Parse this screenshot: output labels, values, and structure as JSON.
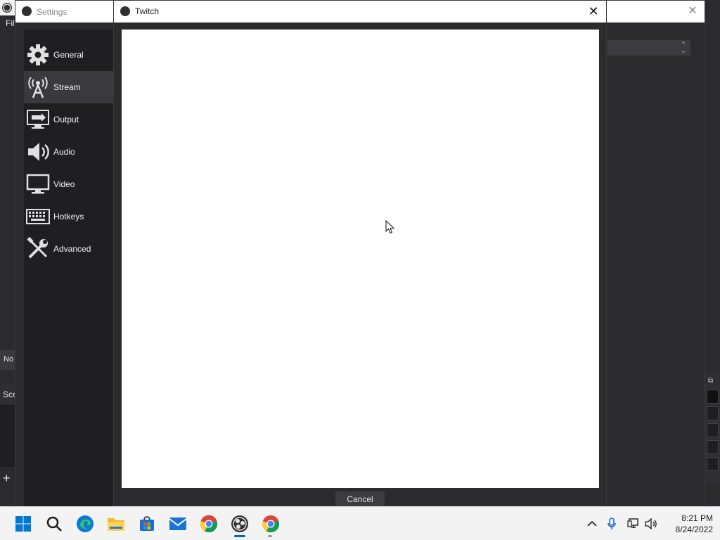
{
  "background_window": {
    "menu_fragment": "Fil",
    "no_fragment": "No",
    "scene_fragment": "Sce",
    "add_symbol": "+"
  },
  "settings": {
    "title": "Settings",
    "sidebar": [
      {
        "label": "General",
        "icon": "gear-icon",
        "active": false
      },
      {
        "label": "Stream",
        "icon": "broadcast-antenna-icon",
        "active": true
      },
      {
        "label": "Output",
        "icon": "output-monitor-icon",
        "active": false
      },
      {
        "label": "Audio",
        "icon": "speaker-icon",
        "active": false
      },
      {
        "label": "Video",
        "icon": "monitor-icon",
        "active": false
      },
      {
        "label": "Hotkeys",
        "icon": "keyboard-icon",
        "active": false
      },
      {
        "label": "Advanced",
        "icon": "tools-icon",
        "active": false
      }
    ]
  },
  "twitch_dialog": {
    "title": "Twitch",
    "cancel_label": "Cancel"
  },
  "taskbar": {
    "apps": [
      "windows-start-icon",
      "search-icon",
      "edge-icon",
      "file-explorer-icon",
      "microsoft-store-icon",
      "mail-icon",
      "chrome-icon",
      "obs-icon",
      "chrome-icon"
    ],
    "clock": {
      "time": "8:21 PM",
      "date": "8/24/2022"
    }
  },
  "colors": {
    "obs_bg": "#2b2b2e",
    "sidebar_bg": "#1f1f22",
    "sidebar_active": "#3a3a3e",
    "accent_blue": "#0067c0"
  }
}
